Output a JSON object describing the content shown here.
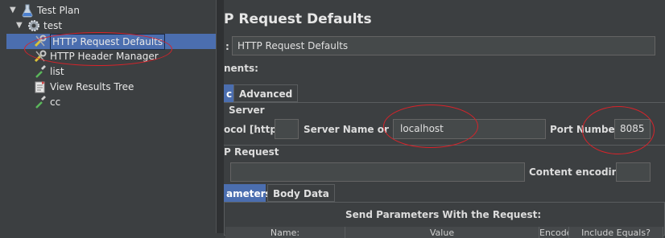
{
  "tree": {
    "nodes": [
      {
        "label": "Test Plan",
        "icon": "test-plan-icon"
      },
      {
        "label": "test",
        "icon": "thread-group-gear-icon"
      },
      {
        "label": "HTTP Request Defaults",
        "icon": "wrench-icon"
      },
      {
        "label": "HTTP Header Manager",
        "icon": "wrench-icon"
      },
      {
        "label": "list",
        "icon": "pipette-sampler-icon"
      },
      {
        "label": "View Results Tree",
        "icon": "listener-icon"
      },
      {
        "label": "cc",
        "icon": "pipette-sampler-icon"
      }
    ]
  },
  "form": {
    "title": "P Request Defaults",
    "name_label": ":",
    "name_value": "HTTP Request Defaults",
    "comments_label": "nents:",
    "tabs": [
      "c",
      "Advanced"
    ],
    "server_group": "Server",
    "protocol_label": "ocol [http]:",
    "protocol_value": "",
    "server_label": "Server Name or IP:",
    "server_value": "localhost",
    "port_label": "Port Number:",
    "port_value": "8085",
    "request_group": "P Request",
    "path_value": "",
    "encoding_label": "Content encoding:",
    "encoding_value": "",
    "param_tabs": [
      "ameters",
      "Body Data"
    ],
    "send_params_title": "Send Parameters With the Request:",
    "columns": [
      "Name:",
      "Value",
      "Encode?",
      "Include Equals?"
    ]
  },
  "colors": {
    "background": "#3c3f41",
    "selection": "#4b6eaf",
    "annotation": "#d8232a"
  }
}
